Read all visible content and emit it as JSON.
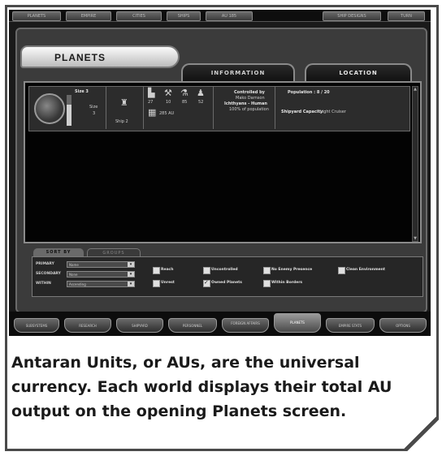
{
  "topbar": {
    "items": [
      "Planets",
      "Empire",
      "Cities",
      "Ships",
      "AU",
      "Ship Designs",
      "Turn"
    ],
    "au_value": "185"
  },
  "planets_tab": "PLANETS",
  "tabs": {
    "information": "INFORMATION",
    "location": "LOCATION"
  },
  "planet_row": {
    "size_label": "Size",
    "size_value": "3",
    "size_bar_fill": 0.68,
    "ships_value": "Ship",
    "ships_count": "2",
    "stats": [
      "27",
      "10",
      "85",
      "52"
    ],
    "au_label": "285 AU",
    "controlled_label": "Controlled by",
    "controller": "Mako Darnson",
    "race": "Ichthyans - Human",
    "race_percent": "100% of population",
    "population_label": "Population : 8 / 20",
    "shipyard_label": "Shipyard Capacity",
    "shipyard_value": "Light Cruiser"
  },
  "sort": {
    "tab_sort": "SORT BY",
    "tab_other": "GROUPS",
    "labels": [
      "PRIMARY",
      "SECONDARY",
      "WITHIN"
    ],
    "selects": [
      "Name",
      "None",
      "Ascending"
    ],
    "checkboxes_row1": [
      {
        "label": "Reach",
        "on": false
      },
      {
        "label": "Uncontrolled",
        "on": false
      },
      {
        "label": "No Enemy Presence",
        "on": false
      },
      {
        "label": "Clean Environment",
        "on": false
      }
    ],
    "checkboxes_row2": [
      {
        "label": "Unrest",
        "on": false
      },
      {
        "label": "Owned Planets",
        "on": true
      },
      {
        "label": "Within Borders",
        "on": false
      }
    ]
  },
  "bottomnav": [
    "Subsystems",
    "Research",
    "Shipyard",
    "Personnel",
    "Foreign Affairs",
    "Planets",
    "Empire Stats",
    "Options"
  ],
  "caption": "Antaran Units, or AUs, are the universal currency. Each world displays their total AU output on the opening Planets screen."
}
